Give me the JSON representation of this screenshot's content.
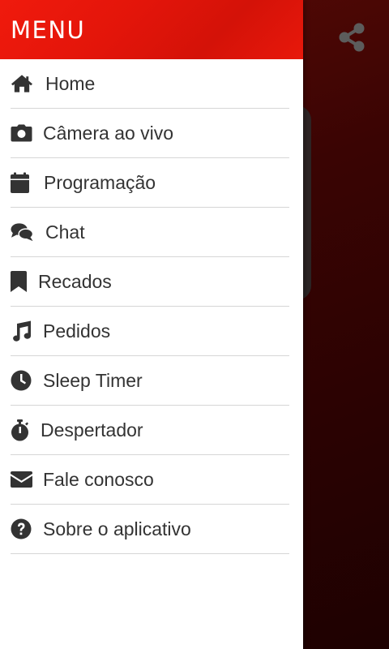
{
  "drawer": {
    "title": "MENU",
    "header_color": "#e3150a",
    "items": [
      {
        "label": "Home",
        "icon": "home-icon"
      },
      {
        "label": "Câmera ao vivo",
        "icon": "camera-icon"
      },
      {
        "label": "Programação",
        "icon": "calendar-icon"
      },
      {
        "label": "Chat",
        "icon": "chat-icon"
      },
      {
        "label": "Recados",
        "icon": "bookmark-icon"
      },
      {
        "label": "Pedidos",
        "icon": "music-note-icon"
      },
      {
        "label": "Sleep Timer",
        "icon": "clock-icon"
      },
      {
        "label": "Despertador",
        "icon": "stopwatch-icon"
      },
      {
        "label": "Fale conosco",
        "icon": "envelope-icon"
      },
      {
        "label": "Sobre o aplicativo",
        "icon": "question-circle-icon"
      }
    ]
  },
  "background": {
    "share_icon": "share-icon",
    "accent_color": "#3a0403"
  }
}
